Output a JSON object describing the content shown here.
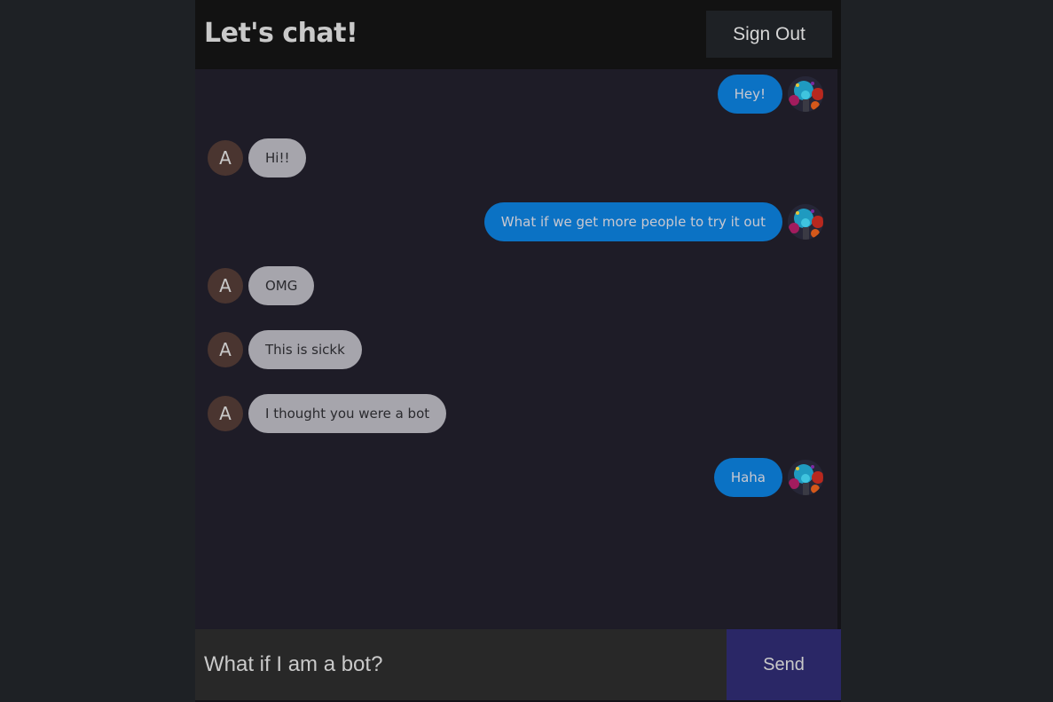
{
  "header": {
    "title": "Let's chat!",
    "sign_out_label": "Sign Out"
  },
  "messages": [
    {
      "direction": "sent",
      "text": "Hey!",
      "avatar": "user-photo"
    },
    {
      "direction": "received",
      "text": "Hi!!",
      "avatar_letter": "A"
    },
    {
      "direction": "sent",
      "text": "What if we get more people to try it out",
      "avatar": "user-photo"
    },
    {
      "direction": "received",
      "text": "OMG",
      "avatar_letter": "A"
    },
    {
      "direction": "received",
      "text": "This is sickk",
      "avatar_letter": "A"
    },
    {
      "direction": "received",
      "text": "I thought you were a bot",
      "avatar_letter": "A"
    },
    {
      "direction": "sent",
      "text": "Haha",
      "avatar": "user-photo"
    }
  ],
  "composer": {
    "input_value": "What if I am a bot?",
    "send_label": "Send"
  },
  "colors": {
    "page_background": "#1e2125",
    "chat_background": "#1e1c27",
    "header_background": "#121212",
    "sent_bubble": "#0b72c4",
    "received_bubble": "#a6a5ac",
    "letter_avatar": "#4a3530",
    "send_button": "#2a2766",
    "input_background": "#282828"
  }
}
